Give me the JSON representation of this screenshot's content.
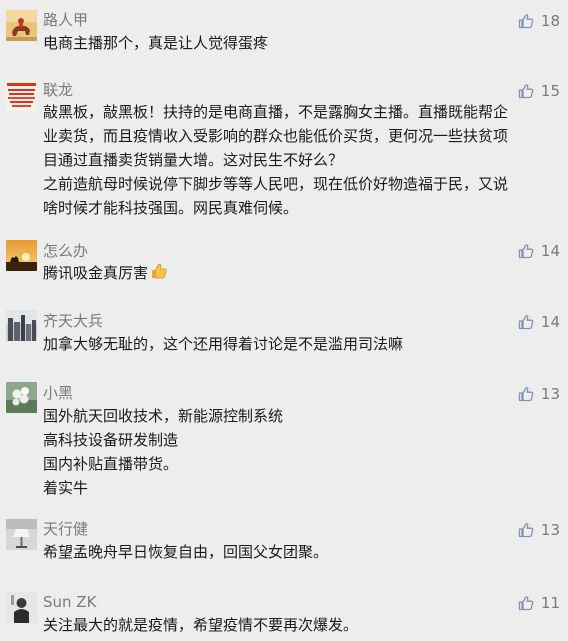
{
  "comments": [
    {
      "name": "路人甲",
      "likes": "18",
      "lines": [
        "电商主播那个，真是让人觉得蛋疼"
      ],
      "avatar": "avatar-horse-rider-icon"
    },
    {
      "name": "联龙",
      "likes": "15",
      "lines": [
        "敲黑板，敲黑板！扶持的是电商直播，不是露胸女主播。直播既能帮企",
        "业卖货，而且疫情收入受影响的群众也能低价买货，更何况一些扶贫项",
        "目通过直播卖货销量大增。这对民生不好么？",
        "之前造航母时候说停下脚步等等人民吧，现在低价好物造福于民，又说",
        "啥时候才能科技强国。网民真难伺候。"
      ],
      "avatar": "avatar-red-text-banner-icon"
    },
    {
      "name": "怎么办",
      "likes": "14",
      "lines": [
        "腾讯吸金真厉害"
      ],
      "emoji": "thumbs-up-emoji",
      "avatar": "avatar-sunset-camel-icon"
    },
    {
      "name": "齐天大兵",
      "likes": "14",
      "lines": [
        "加拿大够无耻的，这个还用得着讨论是不是滥用司法嘛"
      ],
      "avatar": "avatar-city-skyline-icon"
    },
    {
      "name": "小黑",
      "likes": "13",
      "lines": [
        "国外航天回收技术，新能源控制系统",
        "高科技设备研发制造",
        "国内补贴直播带货。",
        "着实牛"
      ],
      "avatar": "avatar-white-flowers-icon"
    },
    {
      "name": "天行健",
      "likes": "13",
      "lines": [
        "希望孟晚舟早日恢复自由，回国父女团聚。"
      ],
      "avatar": "avatar-lamp-icon"
    },
    {
      "name": "Sun ZK",
      "likes": "11",
      "lines": [
        "关注最大的就是疫情，希望疫情不要再次爆发。"
      ],
      "avatar": "avatar-dark-portrait-icon"
    }
  ],
  "colors": {
    "background": "#ededed",
    "name": "#7a7a7a",
    "content": "#1a1a1a",
    "like_icon": "#7f93b3"
  }
}
